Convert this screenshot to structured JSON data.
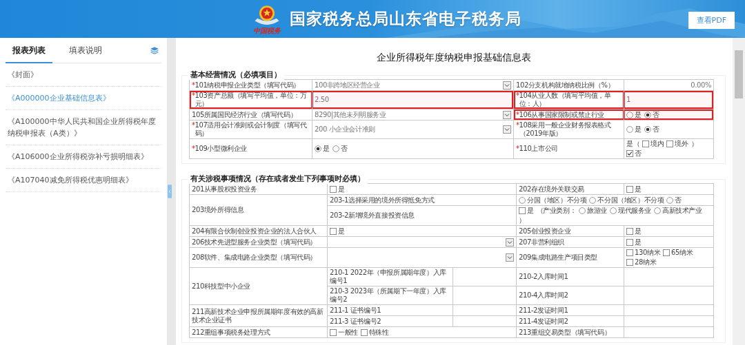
{
  "header": {
    "logo_caption": "中国税务",
    "title": "国家税务总局山东省电子税务局",
    "pdf_button": "查看PDF"
  },
  "sidebar": {
    "tabs": [
      {
        "label": "报表列表",
        "selected": true
      },
      {
        "label": "填表说明",
        "selected": false
      }
    ],
    "items": [
      {
        "label": "《封面》",
        "selected": false
      },
      {
        "label": "《A000000企业基础信息表》",
        "selected": true
      },
      {
        "label": "《A100000中华人民共和国企业所得税年度纳税申报表（A类）》",
        "selected": false
      },
      {
        "label": "《A106000企业所得税弥补亏损明细表》",
        "selected": false
      },
      {
        "label": "《A107040减免所得税优惠明细表》",
        "selected": false
      }
    ]
  },
  "form_title": "企业所得税年度纳税申报基础信息表",
  "sections": [
    {
      "title": "基本经营情况（必填项目）",
      "rows": [
        {
          "cells": [
            {
              "kind": "label",
              "mark": "*",
              "text": "101纳税申报企业类型（填写代码）",
              "highlighted": false
            },
            {
              "kind": "select",
              "value": "100非跨地区经营企业",
              "highlighted": false
            },
            {
              "kind": "label",
              "text": "102分支机构就地纳税比例（%）",
              "highlighted": false
            },
            {
              "kind": "number",
              "value": "0.00%",
              "highlighted": false
            }
          ]
        },
        {
          "cells": [
            {
              "kind": "label",
              "mark": "*",
              "text": "103资产总额（填写平均值，单位：万元）",
              "highlighted": true
            },
            {
              "kind": "text",
              "value": "2.50",
              "highlighted": true
            },
            {
              "kind": "label",
              "mark": "*",
              "text": "104从业人数（填写平均值，单位：人）",
              "highlighted": true
            },
            {
              "kind": "text",
              "value": "1",
              "highlighted": true
            }
          ]
        },
        {
          "cells": [
            {
              "kind": "label",
              "text": "105所属国民经济行业（填写代码）",
              "highlighted": false
            },
            {
              "kind": "select",
              "value": "8290|其他未列明服务业",
              "highlighted": false
            },
            {
              "kind": "label",
              "mark": "*",
              "text": "106从事国家限制或禁止行业",
              "highlighted": true
            },
            {
              "kind": "choice",
              "parts": [
                {
                  "kind": "radio",
                  "label": "是",
                  "selected": false
                },
                {
                  "kind": "radio",
                  "label": "否",
                  "selected": true
                }
              ],
              "highlighted": true
            }
          ]
        },
        {
          "cells": [
            {
              "kind": "label",
              "mark": "*",
              "text": "107适用会计准则或会计制度（填写代码）",
              "highlighted": false
            },
            {
              "kind": "select",
              "value": "200 小企业会计准则",
              "highlighted": false
            },
            {
              "kind": "label",
              "mark": "*",
              "text": "108采用一般企业财务报表格式（2019年版）",
              "highlighted": false
            },
            {
              "kind": "choice",
              "parts": [
                {
                  "kind": "radio",
                  "label": "是",
                  "selected": false
                },
                {
                  "kind": "radio",
                  "label": "否",
                  "selected": true
                }
              ],
              "highlighted": false
            }
          ]
        },
        {
          "cells": [
            {
              "kind": "label",
              "mark": "*",
              "text": "109小型微利企业",
              "highlighted": false
            },
            {
              "kind": "choice",
              "parts": [
                {
                  "kind": "radio",
                  "label": "是",
                  "selected": true
                },
                {
                  "kind": "radio",
                  "label": "否",
                  "selected": false
                }
              ],
              "highlighted": false
            },
            {
              "kind": "label",
              "mark": "*",
              "text": "110上市公司",
              "highlighted": false
            },
            {
              "kind": "choice",
              "parts": [
                {
                  "kind": "text",
                  "label": "是（"
                },
                {
                  "kind": "check",
                  "label": "境内",
                  "checked": false
                },
                {
                  "kind": "check",
                  "label": "境外",
                  "checked": false
                },
                {
                  "kind": "text",
                  "label": "）"
                },
                {
                  "kind": "check",
                  "label": "否",
                  "checked": true
                }
              ],
              "highlighted": false
            }
          ]
        }
      ]
    },
    {
      "title": "有关涉税事项情况（存在或者发生下列事项时必填）",
      "rows": [
        {
          "cells": [
            {
              "kind": "label",
              "text": "201从事股权投资业务"
            },
            {
              "kind": "choice",
              "colspan": 2,
              "parts": [
                {
                  "kind": "check",
                  "label": "是",
                  "checked": false
                }
              ]
            },
            {
              "kind": "label",
              "text": "202存在境外关联交易"
            },
            {
              "kind": "choice",
              "parts": [
                {
                  "kind": "check",
                  "label": "是",
                  "checked": false
                }
              ]
            }
          ]
        },
        {
          "cells": [
            {
              "kind": "label",
              "text": "203境外所得信息",
              "rowspan": 2
            },
            {
              "kind": "label",
              "text": "203-1选择采用的境外所得抵免方式",
              "colspan": 2
            },
            {
              "kind": "choice",
              "colspan": 2,
              "parts": [
                {
                  "kind": "radio",
                  "label": "分国（地区）不分项",
                  "selected": false
                },
                {
                  "kind": "radio",
                  "label": "不分国（地区）不分项",
                  "selected": false
                },
                {
                  "kind": "radio",
                  "label": "否",
                  "selected": false
                }
              ]
            }
          ]
        },
        {
          "cells": [
            {
              "kind": "label",
              "text": "203-2新增境外直接投资信息",
              "colspan": 2
            },
            {
              "kind": "choice",
              "colspan": 2,
              "parts": [
                {
                  "kind": "check",
                  "label": "是",
                  "checked": false
                },
                {
                  "kind": "text",
                  "label": "（产业类别："
                },
                {
                  "kind": "radio",
                  "label": "旅游业",
                  "selected": false
                },
                {
                  "kind": "radio",
                  "label": "现代服务业",
                  "selected": false
                },
                {
                  "kind": "radio",
                  "label": "高新技术产业",
                  "selected": false
                },
                {
                  "kind": "text",
                  "label": "）"
                }
              ]
            }
          ]
        },
        {
          "cells": [
            {
              "kind": "label",
              "text": "204有限合伙制创业投资企业的法人合伙人"
            },
            {
              "kind": "choice",
              "colspan": 2,
              "parts": [
                {
                  "kind": "check",
                  "label": "是",
                  "checked": false
                }
              ]
            },
            {
              "kind": "label",
              "text": "205创业投资企业"
            },
            {
              "kind": "choice",
              "parts": [
                {
                  "kind": "check",
                  "label": "是",
                  "checked": false
                }
              ]
            }
          ]
        },
        {
          "cells": [
            {
              "kind": "label",
              "text": "206技术先进型服务企业类型（填写代码）"
            },
            {
              "kind": "select",
              "colspan": 2
            },
            {
              "kind": "label",
              "text": "207非营利组织"
            },
            {
              "kind": "choice",
              "parts": [
                {
                  "kind": "check",
                  "label": "是",
                  "checked": false
                }
              ]
            }
          ]
        },
        {
          "cells": [
            {
              "kind": "label",
              "text": "208软件、集成电路企业类型（填写代码）"
            },
            {
              "kind": "select",
              "colspan": 2
            },
            {
              "kind": "label",
              "text": "209集成电路生产项目类型"
            },
            {
              "kind": "choice",
              "parts": [
                {
                  "kind": "check",
                  "label": "130纳米",
                  "checked": false
                },
                {
                  "kind": "check",
                  "label": "65纳米",
                  "checked": false
                },
                {
                  "kind": "check",
                  "label": "28纳米",
                  "checked": false
                }
              ]
            }
          ]
        },
        {
          "cells": [
            {
              "kind": "label",
              "text": "210科技型中小企业",
              "rowspan": 2
            },
            {
              "kind": "label",
              "text": "210-1  2022年（申报所属期年度）入库编号1"
            },
            {
              "kind": "text"
            },
            {
              "kind": "label",
              "text": "210-2入库时间1"
            },
            {
              "kind": "text"
            }
          ]
        },
        {
          "cells": [
            {
              "kind": "label",
              "text": "210-3  2023年（所属期下一年度）入库编号2"
            },
            {
              "kind": "text"
            },
            {
              "kind": "label",
              "text": "210-4入库时间2"
            },
            {
              "kind": "text"
            }
          ]
        },
        {
          "cells": [
            {
              "kind": "label",
              "text": "211高新技术企业申报所属期年度有效的高新技术企业证书",
              "rowspan": 2
            },
            {
              "kind": "label",
              "text": "211-1 证书编号1"
            },
            {
              "kind": "text"
            },
            {
              "kind": "label",
              "text": "211-2发证时间1"
            },
            {
              "kind": "text"
            }
          ]
        },
        {
          "cells": [
            {
              "kind": "label",
              "text": "211-3 证书编号2"
            },
            {
              "kind": "text"
            },
            {
              "kind": "label",
              "text": "211-4发证时间2"
            },
            {
              "kind": "text"
            }
          ]
        },
        {
          "cells": [
            {
              "kind": "label",
              "text": "212重组事项税务处理方式"
            },
            {
              "kind": "choice",
              "colspan": 2,
              "parts": [
                {
                  "kind": "check",
                  "label": "一般性",
                  "checked": false
                },
                {
                  "kind": "check",
                  "label": "特殊性",
                  "checked": false
                }
              ]
            },
            {
              "kind": "label",
              "text": "213重组交易类型（填写代码）"
            },
            {
              "kind": "text"
            }
          ]
        }
      ]
    }
  ]
}
